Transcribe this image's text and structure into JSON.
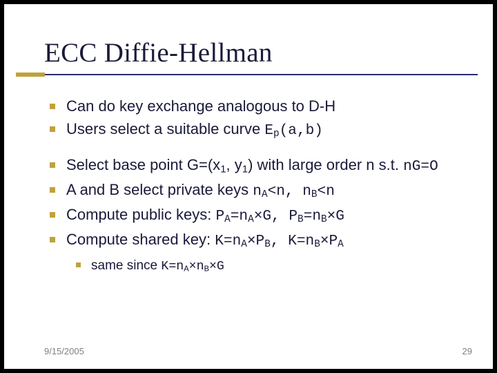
{
  "slide": {
    "title": "ECC Diffie-Hellman",
    "bullets": [
      {
        "html": "Can do key exchange analogous to D-H"
      },
      {
        "html": "Users select a suitable curve <span class=\"mono\">E<sub>p</sub>(a,b)</span>"
      },
      {
        "html": "Select base point G=(x<sub>1</sub>, y<sub>1</sub>) with large order n s.t. <span class=\"mono\">nG=O</span>",
        "gap": true
      },
      {
        "html": "A and B select private keys <span class=\"mono\">n<sub>A</sub>&lt;n, n<sub>B</sub>&lt;n</span>"
      },
      {
        "html": "Compute public keys: <span class=\"mono\">P<sub>A</sub>=n<sub>A</sub>&times;G, P<sub>B</sub>=n<sub>B</sub>&times;G</span>"
      },
      {
        "html": "Compute shared key: <span class=\"mono\">K=n<sub>A</sub>&times;P<sub>B</sub>, K=n<sub>B</sub>&times;P<sub>A</sub></span>",
        "sub": {
          "html": "same since <span class=\"mono\">K=n<sub>A</sub>&times;n<sub>B</sub>&times;G</span>"
        }
      }
    ],
    "footer": {
      "date": "9/15/2005",
      "page": "29"
    }
  }
}
